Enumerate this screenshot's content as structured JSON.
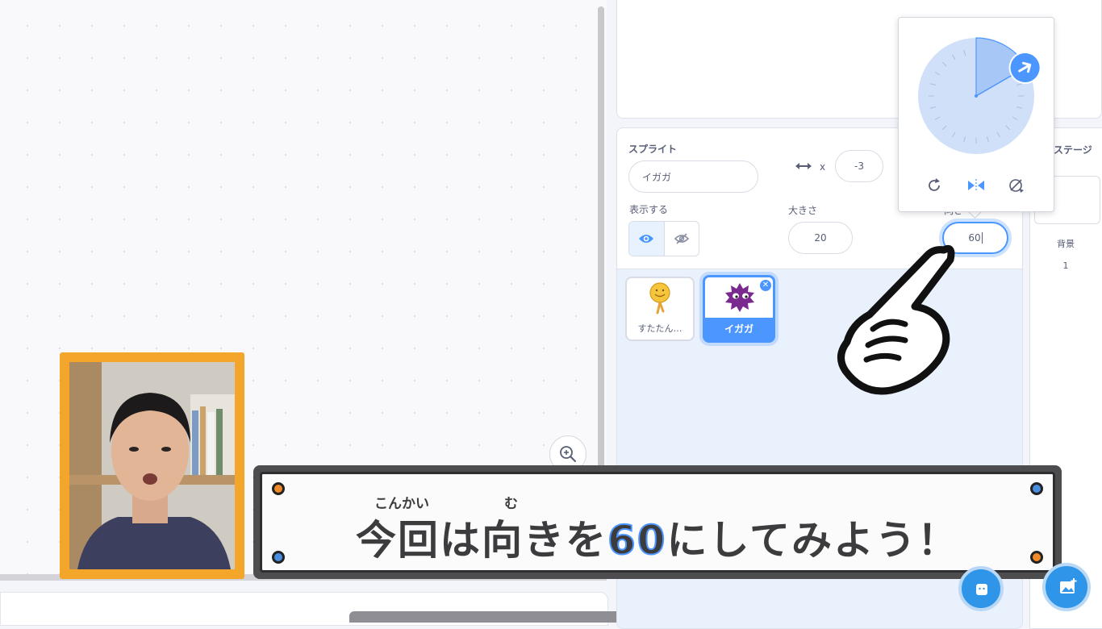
{
  "sprite_info": {
    "section_label": "スプライト",
    "name_value": "イガガ",
    "x_label": "x",
    "x_value": "-3",
    "show_label": "表示する",
    "size_label": "大きさ",
    "size_value": "20",
    "direction_label": "向き",
    "direction_value": "60"
  },
  "sprites": [
    {
      "name": "すたたん…",
      "selected": false
    },
    {
      "name": "イガガ",
      "selected": true
    }
  ],
  "stage_pane": {
    "title": "ステージ",
    "backdrops_label": "背景",
    "backdrops_count": "1"
  },
  "direction_dial": {
    "direction_degrees": 60
  },
  "subtitle": {
    "part1": "今回は向きを",
    "highlight": "60",
    "part2": "にしてみよう！",
    "ruby_konkai": "こんかい",
    "ruby_mu": "む"
  },
  "colors": {
    "accent": "#4c97ff",
    "webcam_frame": "#f4a62a",
    "banner_border": "#4d4d4f"
  }
}
